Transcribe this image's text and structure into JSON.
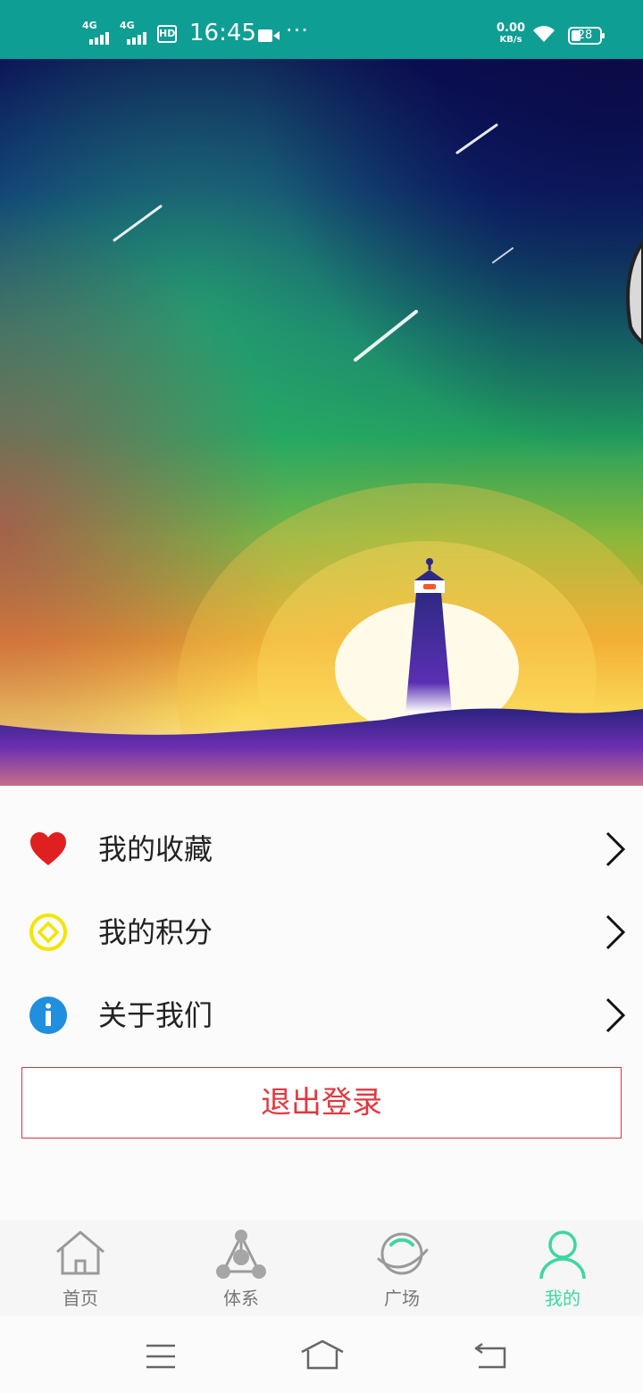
{
  "status_bar": {
    "network_1": "4G",
    "network_2": "4G",
    "hd": "HD",
    "time": "16:45",
    "more": "···",
    "speed_value": "0.00",
    "speed_unit": "KB/s",
    "battery": "28"
  },
  "menu": {
    "items": [
      {
        "label": "我的收藏",
        "icon": "heart-icon"
      },
      {
        "label": "我的积分",
        "icon": "points-coin-icon"
      },
      {
        "label": "关于我们",
        "icon": "info-icon"
      }
    ],
    "logout_label": "退出登录"
  },
  "bottom_nav": {
    "items": [
      {
        "label": "首页",
        "icon": "home-icon"
      },
      {
        "label": "体系",
        "icon": "system-tree-icon"
      },
      {
        "label": "广场",
        "icon": "planet-icon"
      },
      {
        "label": "我的",
        "icon": "user-icon"
      }
    ],
    "active_index": 3
  },
  "colors": {
    "status_bar": "#0f9e94",
    "accent": "#3ed6a4",
    "logout": "#e2383f",
    "heart": "#e02020",
    "coin": "#f2e600",
    "info": "#1f8fde"
  }
}
